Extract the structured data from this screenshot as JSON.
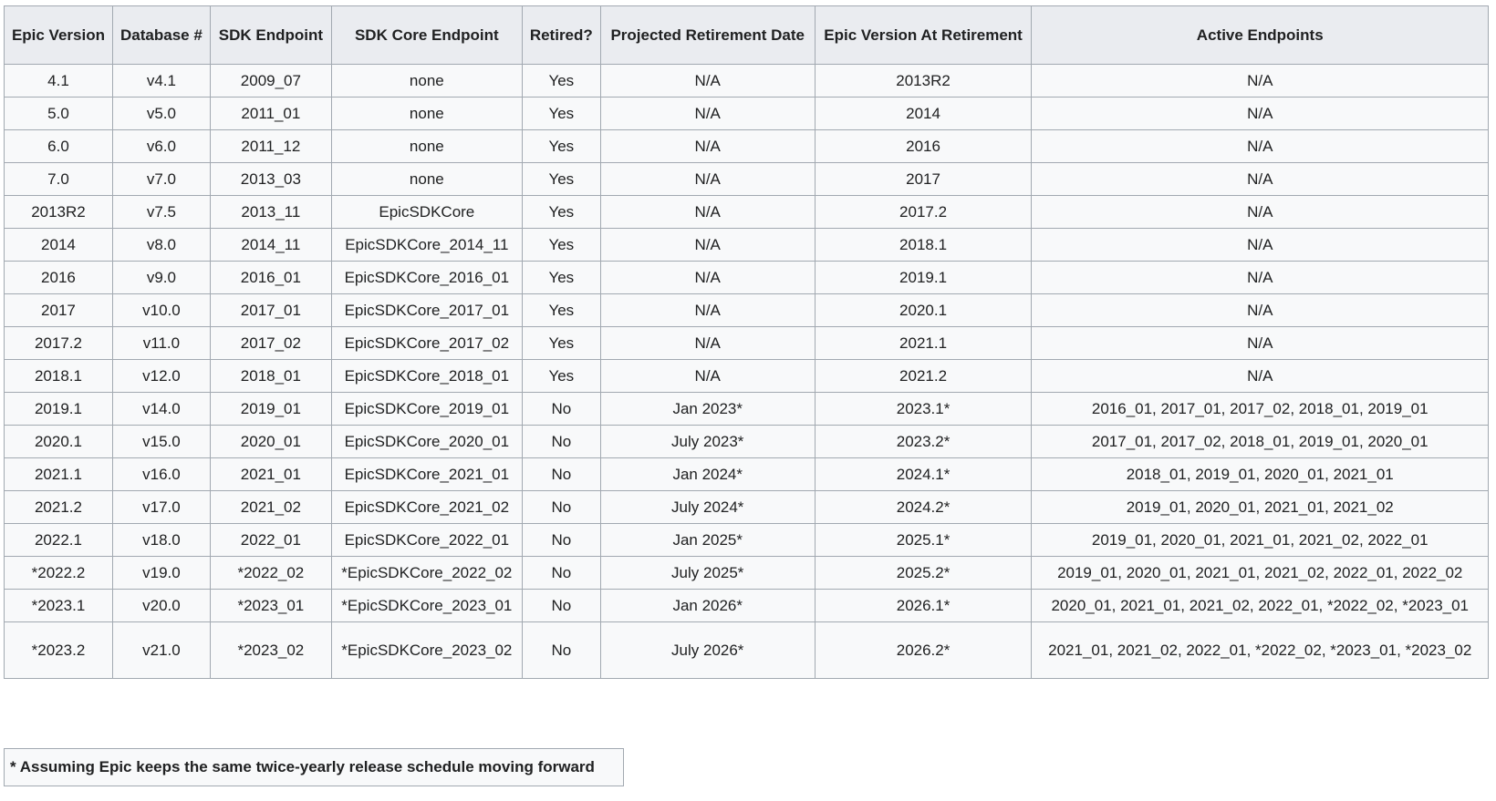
{
  "table": {
    "headers": [
      "Epic Version",
      "Database #",
      "SDK Endpoint",
      "SDK Core Endpoint",
      "Retired?",
      "Projected Retirement Date",
      "Epic Version At Retirement",
      "Active Endpoints"
    ],
    "rows": [
      [
        "4.1",
        "v4.1",
        "2009_07",
        "none",
        "Yes",
        "N/A",
        "2013R2",
        "N/A"
      ],
      [
        "5.0",
        "v5.0",
        "2011_01",
        "none",
        "Yes",
        "N/A",
        "2014",
        "N/A"
      ],
      [
        "6.0",
        "v6.0",
        "2011_12",
        "none",
        "Yes",
        "N/A",
        "2016",
        "N/A"
      ],
      [
        "7.0",
        "v7.0",
        "2013_03",
        "none",
        "Yes",
        "N/A",
        "2017",
        "N/A"
      ],
      [
        "2013R2",
        "v7.5",
        "2013_11",
        "EpicSDKCore",
        "Yes",
        "N/A",
        "2017.2",
        "N/A"
      ],
      [
        "2014",
        "v8.0",
        "2014_11",
        "EpicSDKCore_2014_11",
        "Yes",
        "N/A",
        "2018.1",
        "N/A"
      ],
      [
        "2016",
        "v9.0",
        "2016_01",
        "EpicSDKCore_2016_01",
        "Yes",
        "N/A",
        "2019.1",
        "N/A"
      ],
      [
        "2017",
        "v10.0",
        "2017_01",
        "EpicSDKCore_2017_01",
        "Yes",
        "N/A",
        "2020.1",
        "N/A"
      ],
      [
        "2017.2",
        "v11.0",
        "2017_02",
        "EpicSDKCore_2017_02",
        "Yes",
        "N/A",
        "2021.1",
        "N/A"
      ],
      [
        "2018.1",
        "v12.0",
        "2018_01",
        "EpicSDKCore_2018_01",
        "Yes",
        "N/A",
        "2021.2",
        "N/A"
      ],
      [
        "2019.1",
        "v14.0",
        "2019_01",
        "EpicSDKCore_2019_01",
        "No",
        "Jan 2023*",
        "2023.1*",
        "2016_01, 2017_01, 2017_02, 2018_01, 2019_01"
      ],
      [
        "2020.1",
        "v15.0",
        "2020_01",
        "EpicSDKCore_2020_01",
        "No",
        "July 2023*",
        "2023.2*",
        "2017_01, 2017_02, 2018_01, 2019_01, 2020_01"
      ],
      [
        "2021.1",
        "v16.0",
        "2021_01",
        "EpicSDKCore_2021_01",
        "No",
        "Jan 2024*",
        "2024.1*",
        "2018_01, 2019_01, 2020_01, 2021_01"
      ],
      [
        "2021.2",
        "v17.0",
        "2021_02",
        "EpicSDKCore_2021_02",
        "No",
        "July 2024*",
        "2024.2*",
        "2019_01, 2020_01, 2021_01, 2021_02"
      ],
      [
        "2022.1",
        "v18.0",
        "2022_01",
        "EpicSDKCore_2022_01",
        "No",
        "Jan 2025*",
        "2025.1*",
        "2019_01, 2020_01, 2021_01, 2021_02, 2022_01"
      ],
      [
        "*2022.2",
        "v19.0",
        "*2022_02",
        "*EpicSDKCore_2022_02",
        "No",
        "July 2025*",
        "2025.2*",
        "2019_01, 2020_01, 2021_01, 2021_02, 2022_01, 2022_02"
      ],
      [
        "*2023.1",
        "v20.0",
        "*2023_01",
        "*EpicSDKCore_2023_01",
        "No",
        "Jan 2026*",
        "2026.1*",
        "2020_01, 2021_01, 2021_02, 2022_01, *2022_02, *2023_01"
      ],
      [
        "*2023.2",
        "v21.0",
        "*2023_02",
        "*EpicSDKCore_2023_02",
        "No",
        "July 2026*",
        "2026.2*",
        "2021_01, 2021_02, 2022_01, *2022_02, *2023_01, *2023_02"
      ]
    ]
  },
  "footnote": "* Assuming Epic keeps the same twice-yearly release schedule moving forward"
}
